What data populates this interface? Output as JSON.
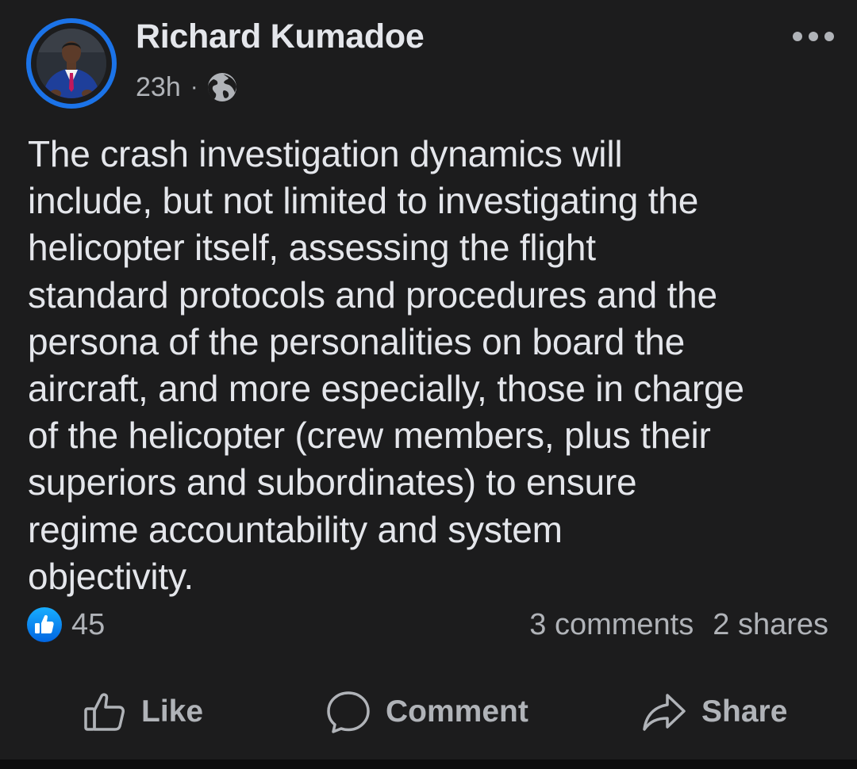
{
  "post": {
    "author_name": "Richard Kumadoe",
    "timestamp": "23h",
    "separator": "·",
    "audience_icon": "globe-icon",
    "body_text": "The crash investigation dynamics will\ninclude, but not limited to investigating the\nhelicopter itself, assessing the flight\nstandard protocols and procedures and the\npersona of the personalities on board the\naircraft, and more especially, those in charge\nof the helicopter (crew members, plus their\nsuperiors and subordinates) to ensure\nregime accountability and system\nobjectivity."
  },
  "stats": {
    "reaction_count": "45",
    "comments": "3 comments",
    "shares": "2 shares"
  },
  "actions": {
    "like_label": "Like",
    "comment_label": "Comment",
    "share_label": "Share"
  },
  "colors": {
    "background": "#1c1c1d",
    "accent": "#1b73e8",
    "primary_text": "#e4e6eb",
    "secondary_text": "#b0b3b8"
  },
  "icons": {
    "more": "more-options-icon",
    "like_badge": "thumbs-up-badge-icon",
    "like": "thumbs-up-icon",
    "comment": "comment-bubble-icon",
    "share": "share-arrow-icon"
  }
}
